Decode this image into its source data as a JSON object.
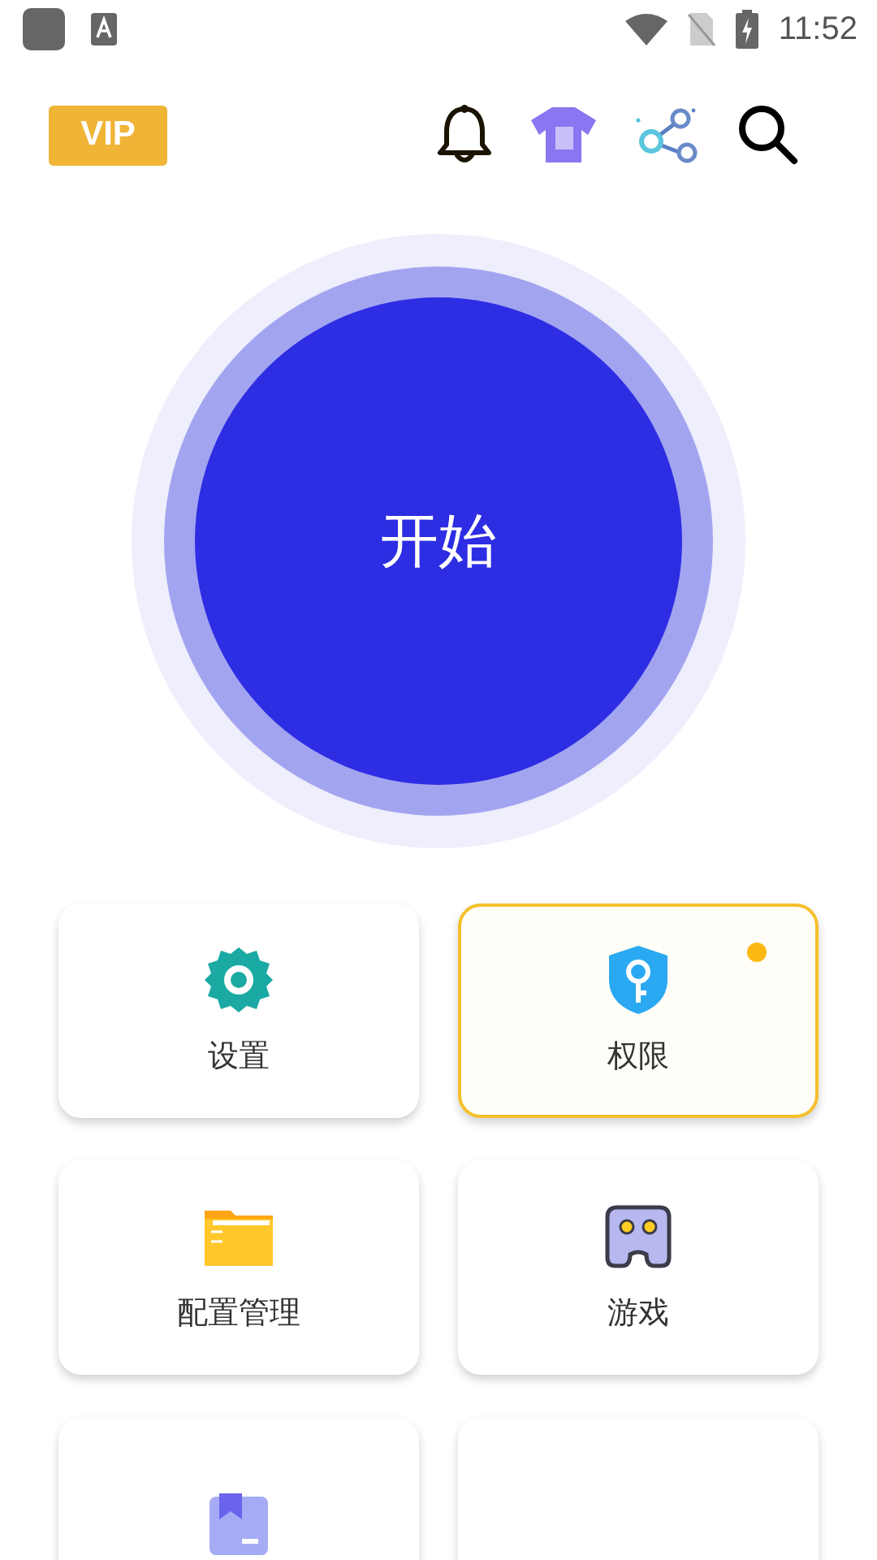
{
  "status_bar": {
    "time": "11:52"
  },
  "header": {
    "vip": "VIP"
  },
  "start_button": {
    "label": "开始"
  },
  "tiles": [
    {
      "kind": "gear",
      "label": "设置",
      "highlighted": false,
      "dot": false
    },
    {
      "kind": "shield",
      "label": "权限",
      "highlighted": true,
      "dot": true
    },
    {
      "kind": "folder",
      "label": "配置管理",
      "highlighted": false,
      "dot": false
    },
    {
      "kind": "gamepad",
      "label": "游戏",
      "highlighted": false,
      "dot": false
    },
    {
      "kind": "box",
      "highlighted": false,
      "dot": false
    },
    {
      "kind": "hidden",
      "highlighted": false,
      "dot": false
    }
  ]
}
